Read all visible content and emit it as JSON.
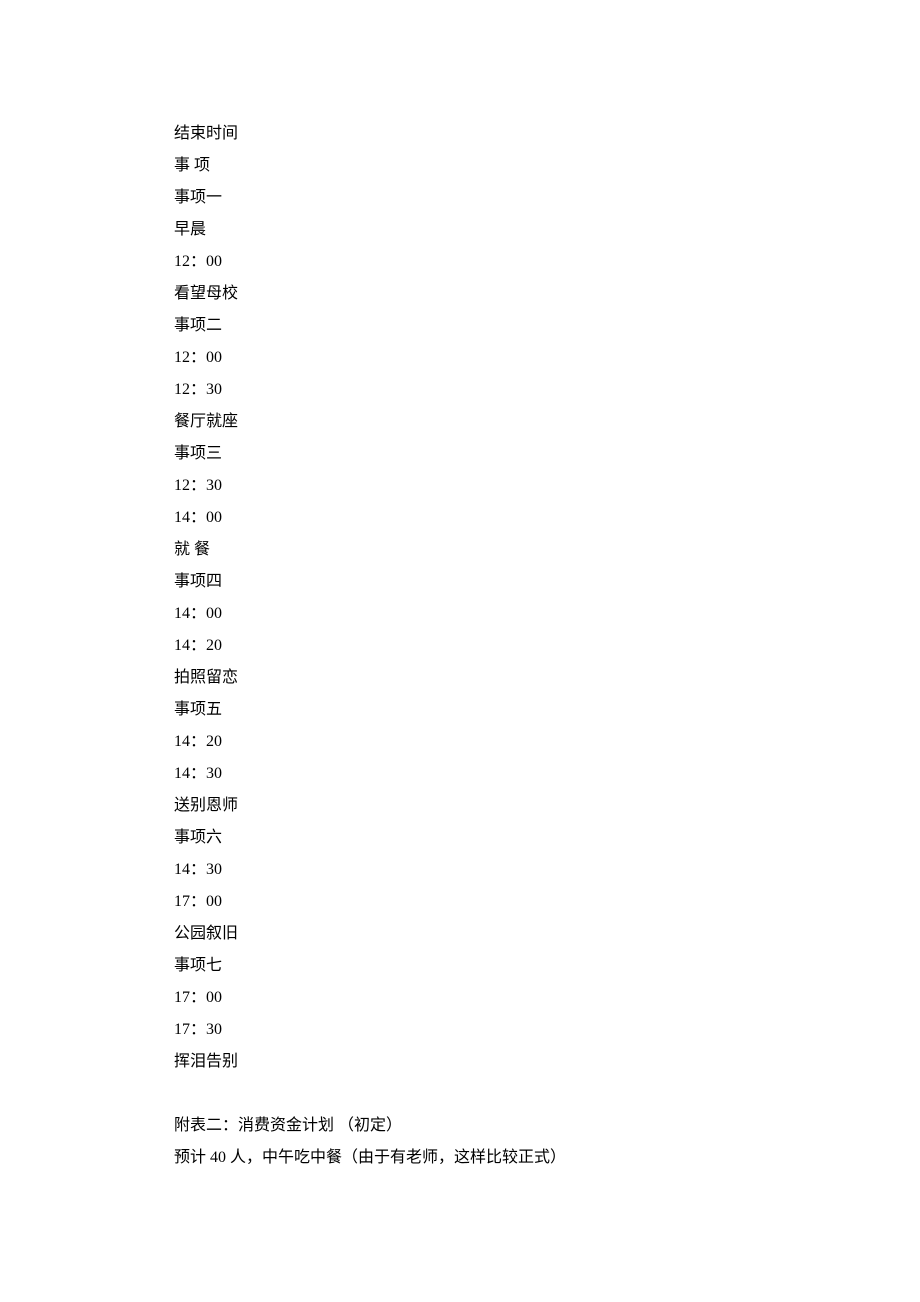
{
  "header": {
    "end_time_label": "结束时间",
    "item_label_char1": "事",
    "item_label_char2": "项"
  },
  "items": [
    {
      "label": "事项一",
      "start": "早晨",
      "end": "12：00",
      "desc": "看望母校"
    },
    {
      "label": "事项二",
      "start": "12：00",
      "end": "12：30",
      "desc": "餐厅就座"
    },
    {
      "label": "事项三",
      "start": "12：30",
      "end": "14：00",
      "desc_char1": "就",
      "desc_char2": "餐"
    },
    {
      "label": "事项四",
      "start": "14：00",
      "end": "14：20",
      "desc": "拍照留恋"
    },
    {
      "label": "事项五",
      "start": "14：20",
      "end": "14：30",
      "desc": "送别恩师"
    },
    {
      "label": "事项六",
      "start": "14：30",
      "end": "17：00",
      "desc": "公园叙旧"
    },
    {
      "label": "事项七",
      "start": "17：00",
      "end": "17：30",
      "desc": "挥泪告别"
    }
  ],
  "appendix": {
    "title": "附表二：消费资金计划 （初定）",
    "note": "预计 40 人，中午吃中餐（由于有老师，这样比较正式）"
  }
}
